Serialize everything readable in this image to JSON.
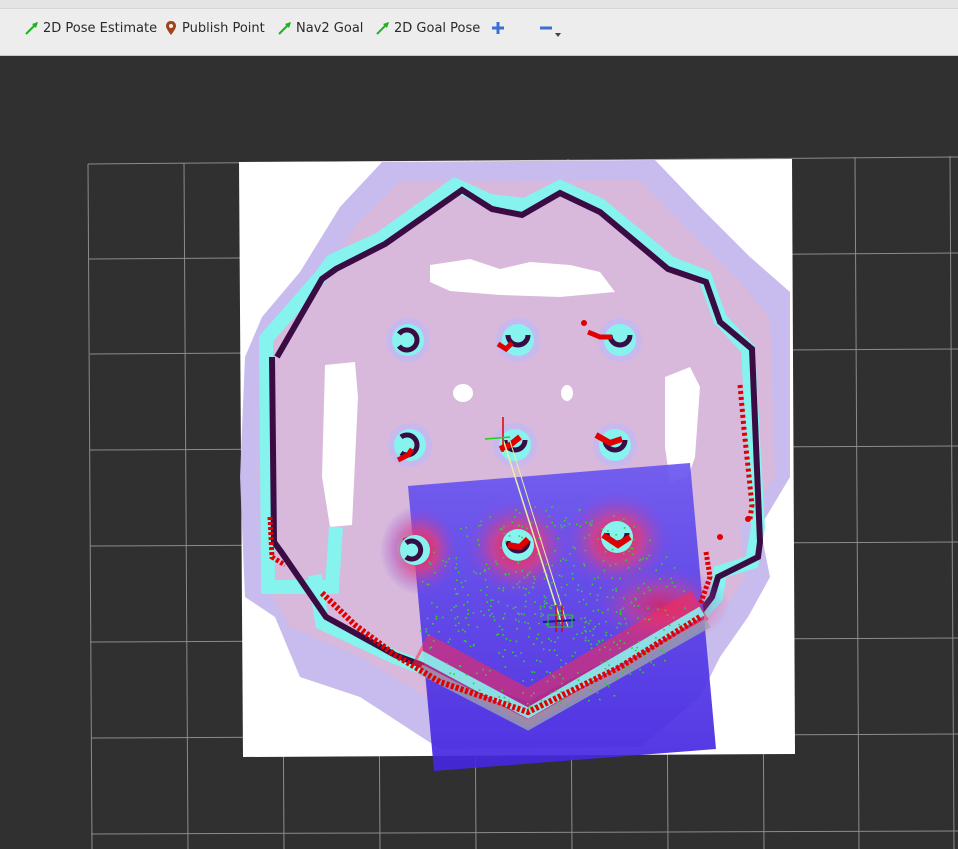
{
  "toolbar": {
    "tools": [
      {
        "label": "2D Pose Estimate",
        "icon": "green-arrow-icon"
      },
      {
        "label": "Publish Point",
        "icon": "map-pin-icon"
      },
      {
        "label": "Nav2 Goal",
        "icon": "green-arrow-icon"
      },
      {
        "label": "2D Goal Pose",
        "icon": "green-arrow-icon"
      }
    ],
    "add_icon": "plus-icon",
    "remove_icon": "minus-icon"
  },
  "colors": {
    "background": "#303030",
    "grid": "#a0a0a0",
    "wall": "#3a0a40",
    "inflation": "#b8aee0",
    "lethal": "#7ff5f0",
    "scan": "#e00000",
    "local_costmap": "#5a3ce8",
    "particles": "#33cc33"
  }
}
